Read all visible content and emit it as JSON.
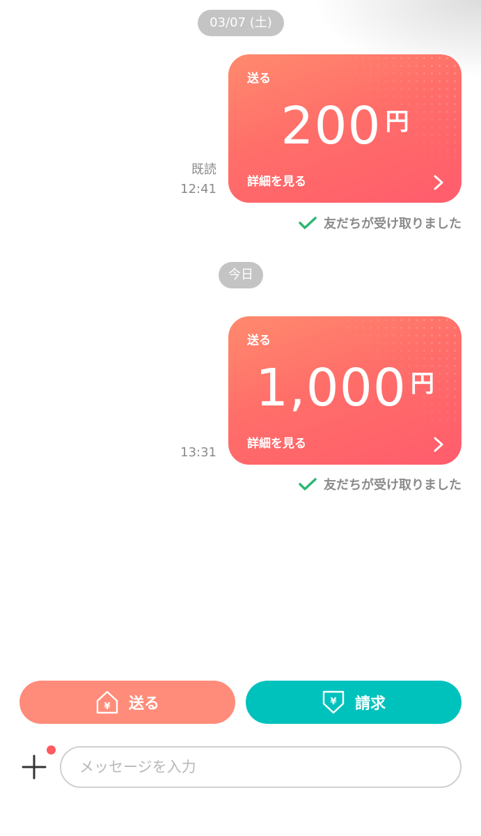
{
  "chat": {
    "date_separators": [
      {
        "label": "03/07 (土)"
      },
      {
        "label": "今日"
      }
    ],
    "messages": [
      {
        "type_label": "送る",
        "amount": "200",
        "currency": "円",
        "details_label": "詳細を見る",
        "read_label": "既読",
        "time": "12:41",
        "status": "友だちが受け取りました"
      },
      {
        "type_label": "送る",
        "amount": "1,000",
        "currency": "円",
        "details_label": "詳細を見る",
        "read_label": "",
        "time": "13:31",
        "status": "友だちが受け取りました"
      }
    ]
  },
  "actions": {
    "send_label": "送る",
    "request_label": "請求"
  },
  "composer": {
    "placeholder": "メッセージを入力",
    "value": ""
  },
  "colors": {
    "card_gradient_start": "#ff8a6e",
    "card_gradient_end": "#ff5c6c",
    "send_button": "#ff8c7a",
    "request_button": "#00c2bd",
    "check_green": "#2bb673",
    "badge_red": "#ff5a5f"
  },
  "icons": {
    "send": "house-yen-icon",
    "request": "arrow-down-yen-icon",
    "plus": "plus-icon",
    "check": "check-icon",
    "chevron": "chevron-right-icon"
  }
}
